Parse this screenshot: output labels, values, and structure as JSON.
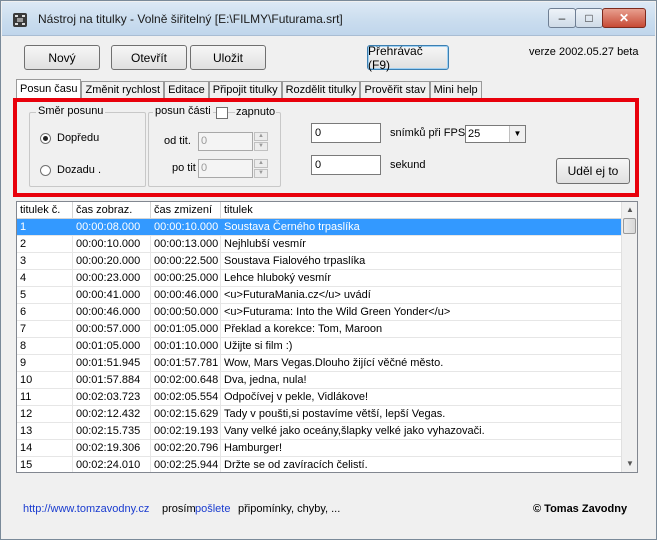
{
  "window": {
    "title": "Nástroj na titulky - Volně šiřitelný [E:\\FILMY\\Futurama.srt]",
    "controls": {
      "minimize": "–",
      "maximize": "□",
      "close": "✕"
    }
  },
  "toolbar": {
    "new_label": "Nový",
    "open_label": "Otevřít",
    "save_label": "Uložit",
    "player_label": "Přehrávač (F9)",
    "version": "verze  2002.05.27 beta"
  },
  "tabs": [
    {
      "label": "Posun času"
    },
    {
      "label": "Změnit rychlost"
    },
    {
      "label": "Editace"
    },
    {
      "label": "Připojit titulky"
    },
    {
      "label": "Rozdělit titulky"
    },
    {
      "label": "Prověřit stav"
    },
    {
      "label": "Mini help"
    }
  ],
  "shift_panel": {
    "direction_group": "Směr posunu",
    "forward_label": "Dopředu",
    "backward_label": "Dozadu .",
    "part_group": "posun části",
    "enabled_label": "zapnuto",
    "from_label": "od tit.",
    "from_value": "0",
    "to_label": "po tit",
    "to_value": "0",
    "frames_value": "0",
    "frames_label": "snímků při FPS",
    "fps_value": "25",
    "seconds_value": "0",
    "seconds_label": "sekund",
    "apply_label": "Uděl ej to"
  },
  "table": {
    "headers": [
      "titulek č.",
      "čas zobraz.",
      "čas zmizení",
      "titulek"
    ],
    "rows": [
      [
        "1",
        "00:00:08.000",
        "00:00:10.000",
        "Soustava Černého trpaslíka"
      ],
      [
        "2",
        "00:00:10.000",
        "00:00:13.000",
        "Nejhlubší vesmír"
      ],
      [
        "3",
        "00:00:20.000",
        "00:00:22.500",
        "Soustava Fialového trpaslíka"
      ],
      [
        "4",
        "00:00:23.000",
        "00:00:25.000",
        "Lehce hluboký vesmír"
      ],
      [
        "5",
        "00:00:41.000",
        "00:00:46.000",
        "<u>FuturaMania.cz</u> uvádí"
      ],
      [
        "6",
        "00:00:46.000",
        "00:00:50.000",
        "<u>Futurama: Into the Wild Green Yonder</u>"
      ],
      [
        "7",
        "00:00:57.000",
        "00:01:05.000",
        "Překlad a korekce: Tom, Maroon"
      ],
      [
        "8",
        "00:01:05.000",
        "00:01:10.000",
        "Užijte si film :)"
      ],
      [
        "9",
        "00:01:51.945",
        "00:01:57.781",
        "Wow, Mars Vegas.Dlouho žijící věčné město."
      ],
      [
        "10",
        "00:01:57.884",
        "00:02:00.648",
        "Dva, jedna, nula!"
      ],
      [
        "11",
        "00:02:03.723",
        "00:02:05.554",
        "Odpočívej v pekle, Vidlákove!"
      ],
      [
        "12",
        "00:02:12.432",
        "00:02:15.629",
        "Tady v poušti,si postavíme větší, lepší Vegas."
      ],
      [
        "13",
        "00:02:15.735",
        "00:02:19.193",
        "Vany velké jako oceány,šlapky velké jako vyhazovači."
      ],
      [
        "14",
        "00:02:19.306",
        "00:02:20.796",
        "Hamburger!"
      ],
      [
        "15",
        "00:02:24.010",
        "00:02:25.944",
        "Držte se od zavíracích čelistí."
      ]
    ],
    "scroll": {
      "up": "▲",
      "down": "▼"
    }
  },
  "statusbar": {
    "url": "http://www.tomzavodny.cz",
    "text_before": "prosím",
    "send_link": "pošlete",
    "text_after": "připomínky, chyby, ...",
    "copyright": "© Tomas Zavodny"
  }
}
